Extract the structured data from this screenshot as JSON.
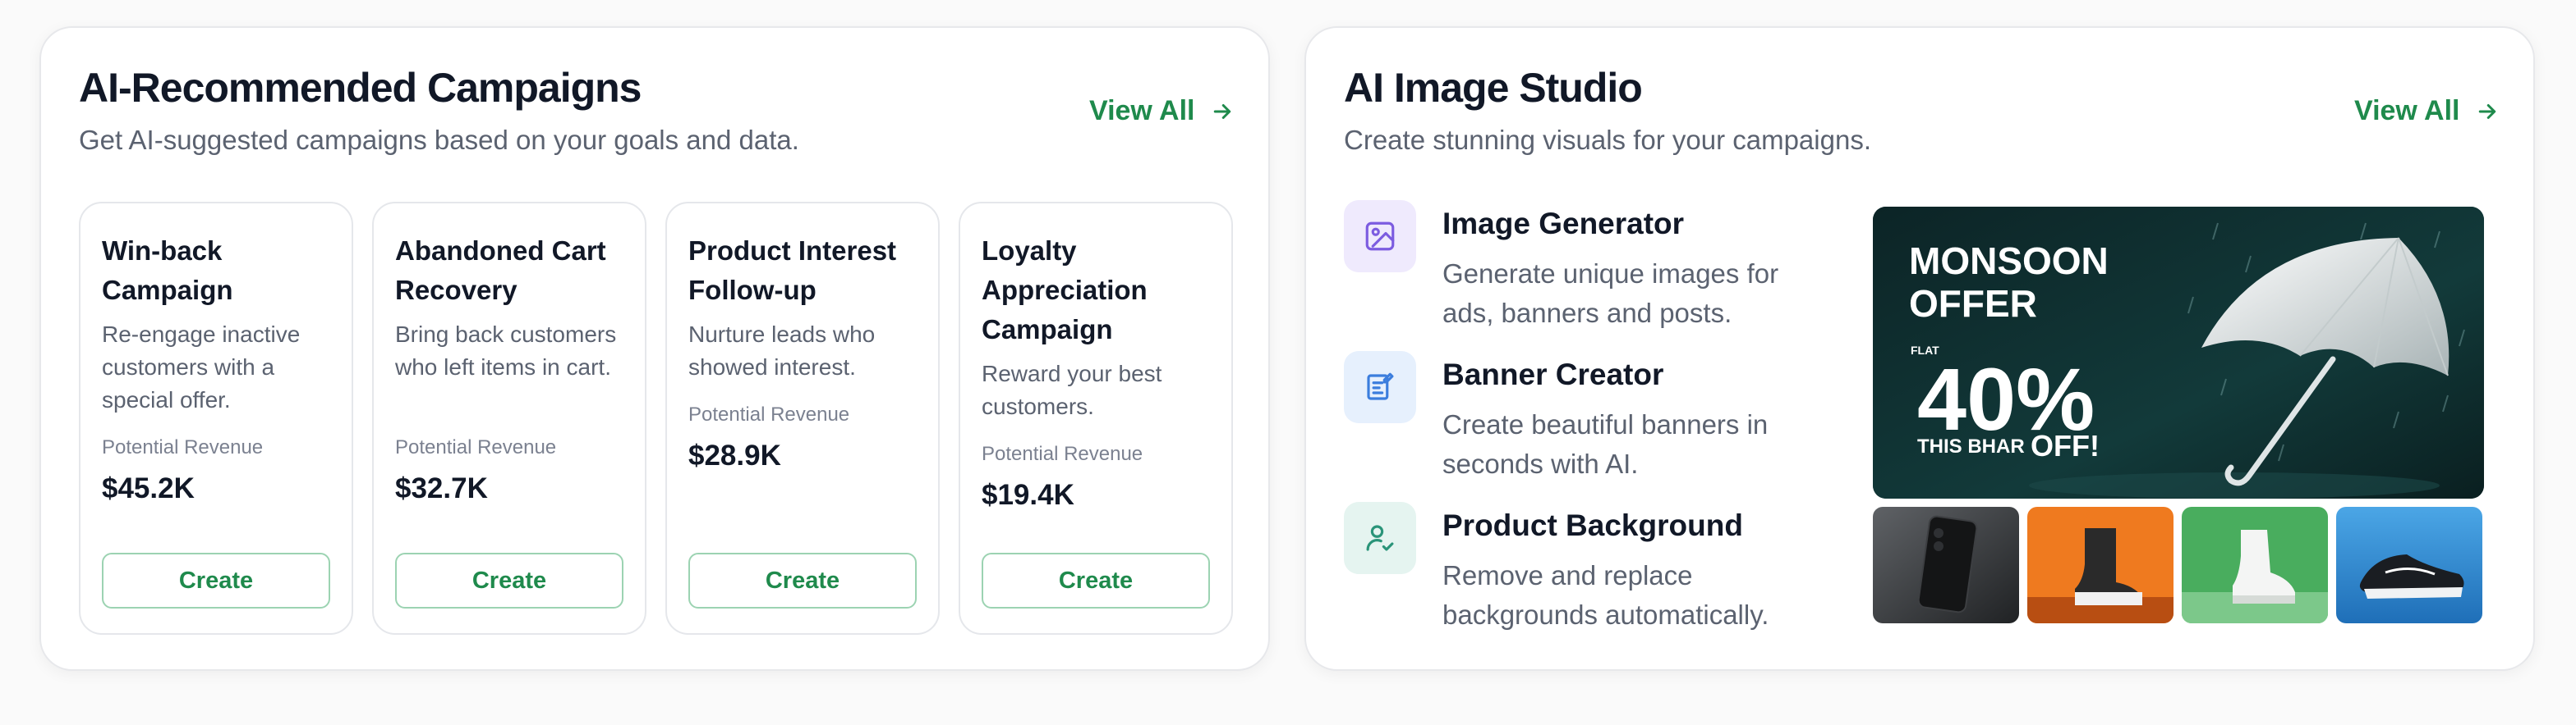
{
  "left_panel": {
    "title": "AI-Recommended Campaigns",
    "subtitle": "Get AI-suggested campaigns based on your goals and data.",
    "view_all": "View All",
    "campaigns": [
      {
        "title": "Win-back Campaign",
        "description": "Re-engage inactive customers with a special offer.",
        "revenue_label": "Potential Revenue",
        "revenue": "$45.2K",
        "button": "Create"
      },
      {
        "title": "Abandoned Cart Recovery",
        "description": "Bring back customers who left items in cart.",
        "revenue_label": "Potential Revenue",
        "revenue": "$32.7K",
        "button": "Create"
      },
      {
        "title": "Product Interest Follow-up",
        "description": "Nurture leads who showed interest.",
        "revenue_label": "Potential Revenue",
        "revenue": "$28.9K",
        "button": "Create"
      },
      {
        "title": "Loyalty Appreciation Campaign",
        "description": "Reward your best customers.",
        "revenue_label": "Potential Revenue",
        "revenue": "$19.4K",
        "button": "Create"
      }
    ]
  },
  "right_panel": {
    "title": "AI Image Studio",
    "subtitle": "Create stunning visuals for your campaigns.",
    "view_all": "View All",
    "tools": [
      {
        "title": "Image Generator",
        "description": "Generate unique images for ads, banners and posts.",
        "icon": "image-icon"
      },
      {
        "title": "Banner Creator",
        "description": "Create beautiful banners in seconds with AI.",
        "icon": "banner-edit-icon"
      },
      {
        "title": "Product Background",
        "description": "Remove and replace backgrounds automatically.",
        "icon": "user-check-icon"
      }
    ],
    "banner": {
      "line1": "MONSOON",
      "line2": "OFFER",
      "flat": "FLAT",
      "percent": "40%",
      "this_bhar": "THIS BHAR",
      "off": "OFF!"
    },
    "thumbnails": [
      "smartphone-thumbnail",
      "boot-thumbnail",
      "sneaker-white-thumbnail",
      "sneaker-running-thumbnail"
    ]
  },
  "colors": {
    "accent_green": "#1f8a4c",
    "icon_purple_bg": "#efeafd",
    "icon_blue_bg": "#e6f0fd",
    "icon_teal_bg": "#e5f4f0"
  }
}
